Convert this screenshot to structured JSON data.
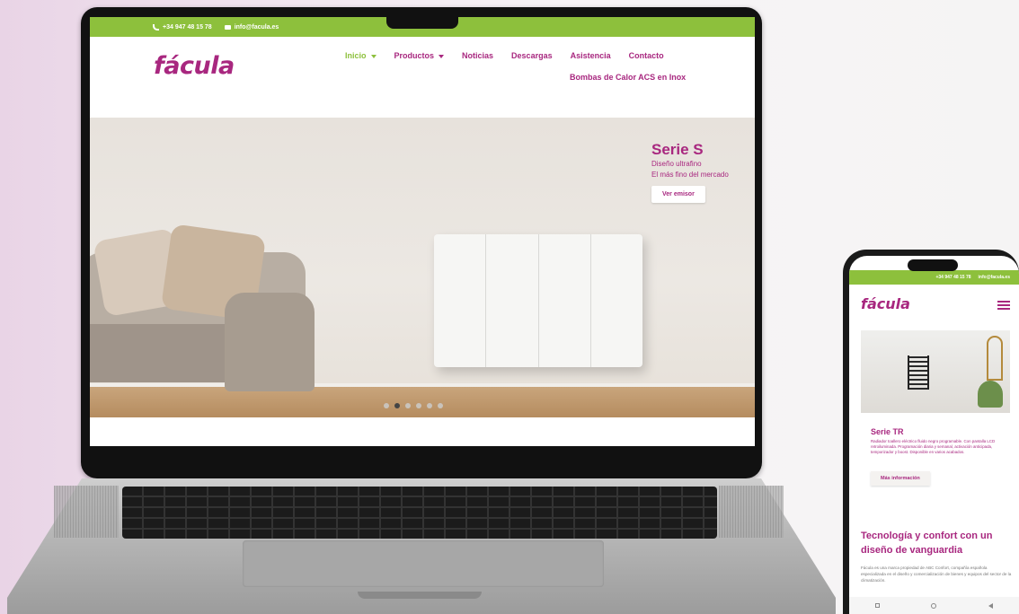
{
  "laptop": {
    "topbar": {
      "phone": "+34 947 48 15 78",
      "email": "info@facula.es"
    },
    "logo": "fácula",
    "menu": {
      "inicio": "Inicio",
      "productos": "Productos",
      "noticias": "Noticias",
      "descargas": "Descargas",
      "asistencia": "Asistencia",
      "contacto": "Contacto",
      "bombas": "Bombas de Calor ACS en Inox"
    },
    "hero": {
      "title": "Serie S",
      "line1": "Diseño ultrafino",
      "line2": "El más fino del mercado",
      "button": "Ver emisor",
      "slides": 6,
      "active_slide": 2
    }
  },
  "phone": {
    "topbar": {
      "phone": "+34 947 48 15 78",
      "email": "info@facula.es"
    },
    "logo": "fácula",
    "product_title": "Serie TR",
    "product_desc": "Radiador toallero eléctrico fluido negro programable. Con pantalla LCD retroiluminada. Programación diaria y semanal, activación anticipada, temporizador y boost. Disponible en varios acabados.",
    "product_button": "Más información",
    "section_title": "Tecnología y confort con un diseño de vanguardia",
    "section_body": "Fácula es una marca propiedad de ABC Confort, compañía española especializada en el diseño y comercialización de bienes y equipos del sector de la climatización."
  },
  "colors": {
    "brand": "#a8277f",
    "accent": "#8dc03c"
  }
}
